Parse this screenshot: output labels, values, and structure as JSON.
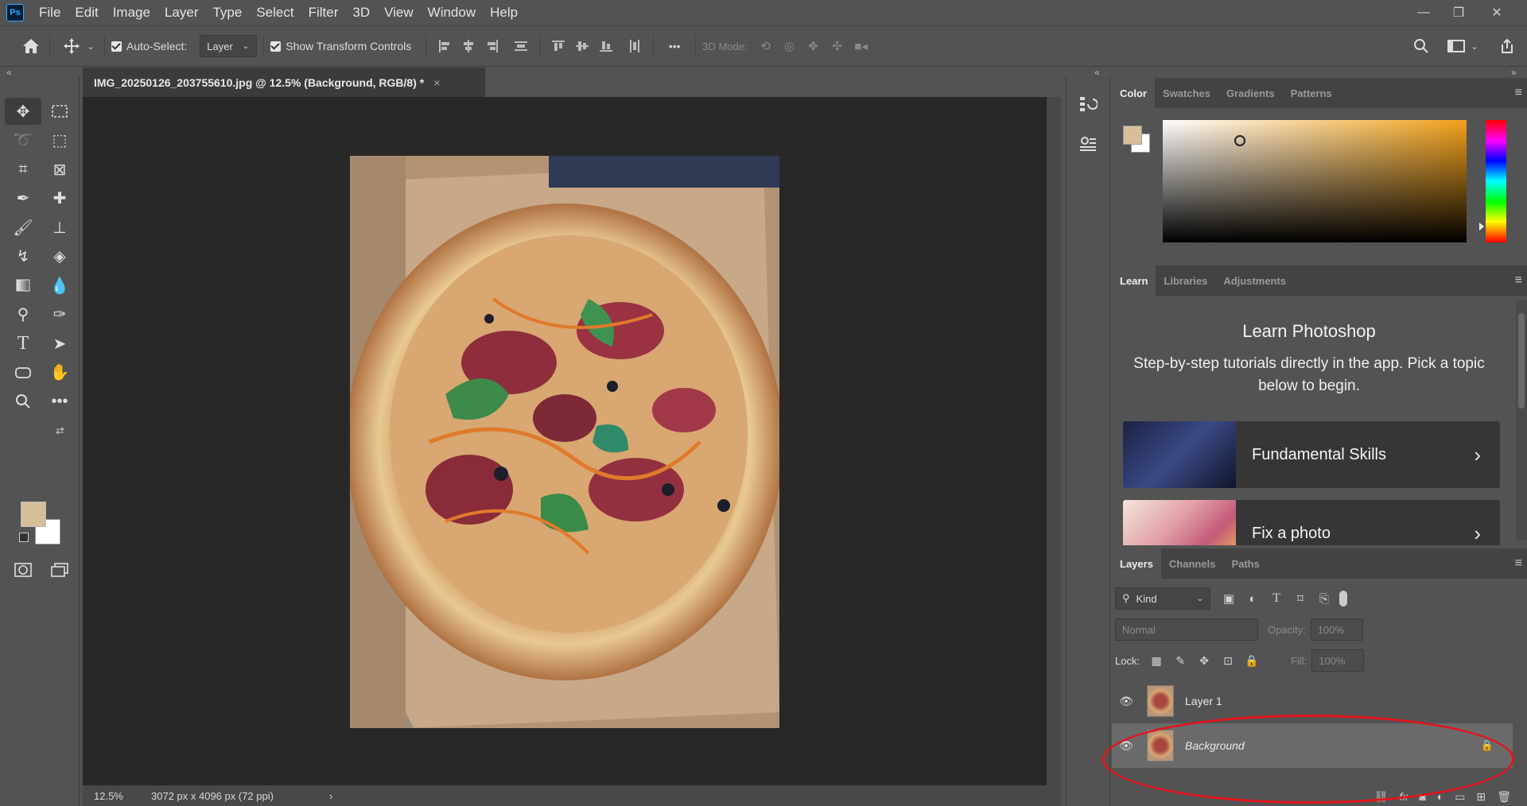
{
  "app": {
    "logo": "Ps"
  },
  "menu": [
    "File",
    "Edit",
    "Image",
    "Layer",
    "Type",
    "Select",
    "Filter",
    "3D",
    "View",
    "Window",
    "Help"
  ],
  "window_controls": {
    "minimize": "—",
    "restore": "❐",
    "close": "✕"
  },
  "options": {
    "auto_select_label": "Auto-Select:",
    "auto_select_target": "Layer",
    "show_transform_label": "Show Transform Controls",
    "three_d_mode_label": "3D Mode:",
    "more_label": "•••"
  },
  "document": {
    "tab_title": "IMG_20250126_203755610.jpg @ 12.5% (Background, RGB/8) *",
    "close_glyph": "×",
    "zoom": "12.5%",
    "doc_info": "3072 px x 4096 px (72 ppi)",
    "status_arrow": "›"
  },
  "color_panel": {
    "tabs": [
      "Color",
      "Swatches",
      "Gradients",
      "Patterns"
    ],
    "foreground": "#d7bf9a",
    "background": "#ffffff"
  },
  "learn_panel": {
    "tabs": [
      "Learn",
      "Libraries",
      "Adjustments"
    ],
    "title": "Learn Photoshop",
    "subtitle": "Step-by-step tutorials directly in the app. Pick a topic below to begin.",
    "cards": [
      {
        "label": "Fundamental Skills",
        "chevron": "›"
      },
      {
        "label": "Fix a photo",
        "chevron": "›"
      }
    ]
  },
  "layers_panel": {
    "tabs": [
      "Layers",
      "Channels",
      "Paths"
    ],
    "filter_kind": "Kind",
    "blend_mode": "Normal",
    "opacity_label": "Opacity:",
    "opacity_value": "100%",
    "lock_label": "Lock:",
    "fill_label": "Fill:",
    "fill_value": "100%",
    "layers": [
      {
        "name": "Layer 1"
      },
      {
        "name": "Background"
      }
    ]
  },
  "colors": {
    "highlight": "#e4141b",
    "accent": "#31a8ff"
  }
}
